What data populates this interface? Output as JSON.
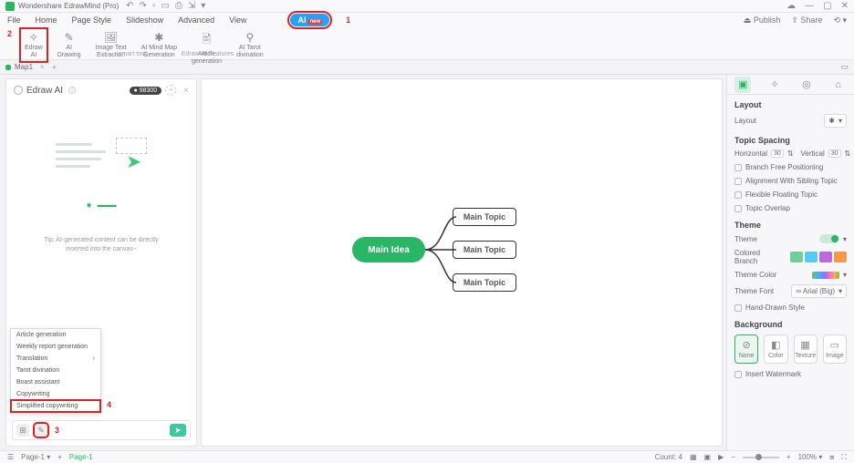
{
  "titlebar": {
    "app": "Wondershare EdrawMind (Pro)",
    "share": "Share",
    "publish": "Publish"
  },
  "menu": {
    "items": [
      "File",
      "Home",
      "Page Style",
      "Slideshow",
      "Advanced",
      "View"
    ],
    "ai_label": "AI",
    "ai_badge": "new",
    "annot1": "1",
    "annot2": "2"
  },
  "ribbon": {
    "items": [
      {
        "icon": "✧",
        "label": "Edraw\nAI"
      },
      {
        "icon": "✎",
        "label": "AI\nDrawing"
      },
      {
        "icon": "🖼",
        "label": "Image Text\nExtraction"
      },
      {
        "icon": "✱",
        "label": "AI Mind Map\nGeneration"
      },
      {
        "icon": "🖹",
        "label": "Article\ngeneration"
      },
      {
        "icon": "⚲",
        "label": "AI Tarot\ndivination"
      }
    ],
    "caption_smart": "smart tool",
    "caption_features": "Edraw AI Features"
  },
  "doctab": {
    "name": "Map1"
  },
  "left_panel": {
    "title": "Edraw AI",
    "coins": "98300",
    "tip": "Tip: AI-generated content can be directly\ninserted into the canvas~",
    "annot3": "3",
    "annot4": "4"
  },
  "context_menu": {
    "items": [
      "Article generation",
      "Weekly report generation",
      "Translation",
      "Tarot divination",
      "Boast assistant",
      "Copywriting",
      "Simplified copywriting"
    ],
    "highlight_index": 6
  },
  "mindmap": {
    "main": "Main Idea",
    "topics": [
      "Main Topic",
      "Main Topic",
      "Main Topic"
    ]
  },
  "right": {
    "section_layout": "Layout",
    "label_layout": "Layout",
    "section_spacing": "Topic Spacing",
    "h_label": "Horizontal",
    "h_val": "30",
    "v_label": "Vertical",
    "v_val": "30",
    "chk_branchfree": "Branch Free Positioning",
    "chk_align": "Alignment With Sibling Topic",
    "chk_flex": "Flexible Floating Topic",
    "chk_overlap": "Topic Overlap",
    "section_theme": "Theme",
    "label_theme": "Theme",
    "label_colored": "Colored Branch",
    "label_themecolor": "Theme Color",
    "label_font": "Theme Font",
    "font_value": "∞ Arial (Big)",
    "chk_hand": "Hand-Drawn Style",
    "section_bg": "Background",
    "bg_opts": [
      "None",
      "Color",
      "Texture",
      "Image"
    ],
    "chk_watermark": "Insert Watermark",
    "swatch_colors": [
      "#6fcf97",
      "#56ccf2",
      "#bb6bd9",
      "#f2994a"
    ]
  },
  "status": {
    "page_label": "Page-1",
    "page_center": "Page-1",
    "count": "Count: 4",
    "zoom": "100%"
  }
}
